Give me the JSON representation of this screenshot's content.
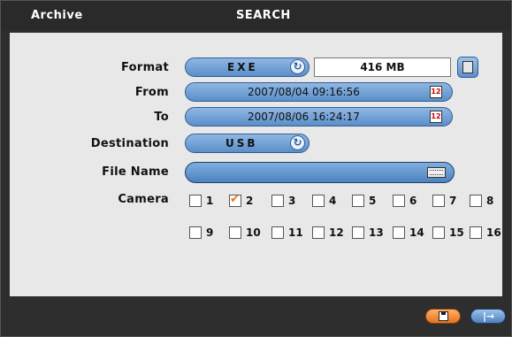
{
  "header": {
    "left_title": "Archive",
    "center_title": "SEARCH"
  },
  "form": {
    "format": {
      "label": "Format",
      "value": "EXE",
      "size": "416 MB"
    },
    "from": {
      "label": "From",
      "value": "2007/08/04  09:16:56"
    },
    "to": {
      "label": "To",
      "value": "2007/08/06  16:24:17"
    },
    "destination": {
      "label": "Destination",
      "value": "USB"
    },
    "file_name": {
      "label": "File Name",
      "value": ""
    },
    "camera": {
      "label": "Camera",
      "items": [
        {
          "label": "1",
          "checked": false
        },
        {
          "label": "2",
          "checked": true
        },
        {
          "label": "3",
          "checked": false
        },
        {
          "label": "4",
          "checked": false
        },
        {
          "label": "5",
          "checked": false
        },
        {
          "label": "6",
          "checked": false
        },
        {
          "label": "7",
          "checked": false
        },
        {
          "label": "8",
          "checked": false
        },
        {
          "label": "9",
          "checked": false
        },
        {
          "label": "10",
          "checked": false
        },
        {
          "label": "11",
          "checked": false
        },
        {
          "label": "12",
          "checked": false
        },
        {
          "label": "13",
          "checked": false
        },
        {
          "label": "14",
          "checked": false
        },
        {
          "label": "15",
          "checked": false
        },
        {
          "label": "16",
          "checked": false
        }
      ]
    }
  },
  "icons": {
    "refresh": "refresh-icon",
    "calculator": "calculator-icon",
    "calendar": "calendar-icon",
    "keyboard": "keyboard-icon",
    "save": "save-icon",
    "exit": "exit-icon"
  },
  "calendar_glyph": "12"
}
